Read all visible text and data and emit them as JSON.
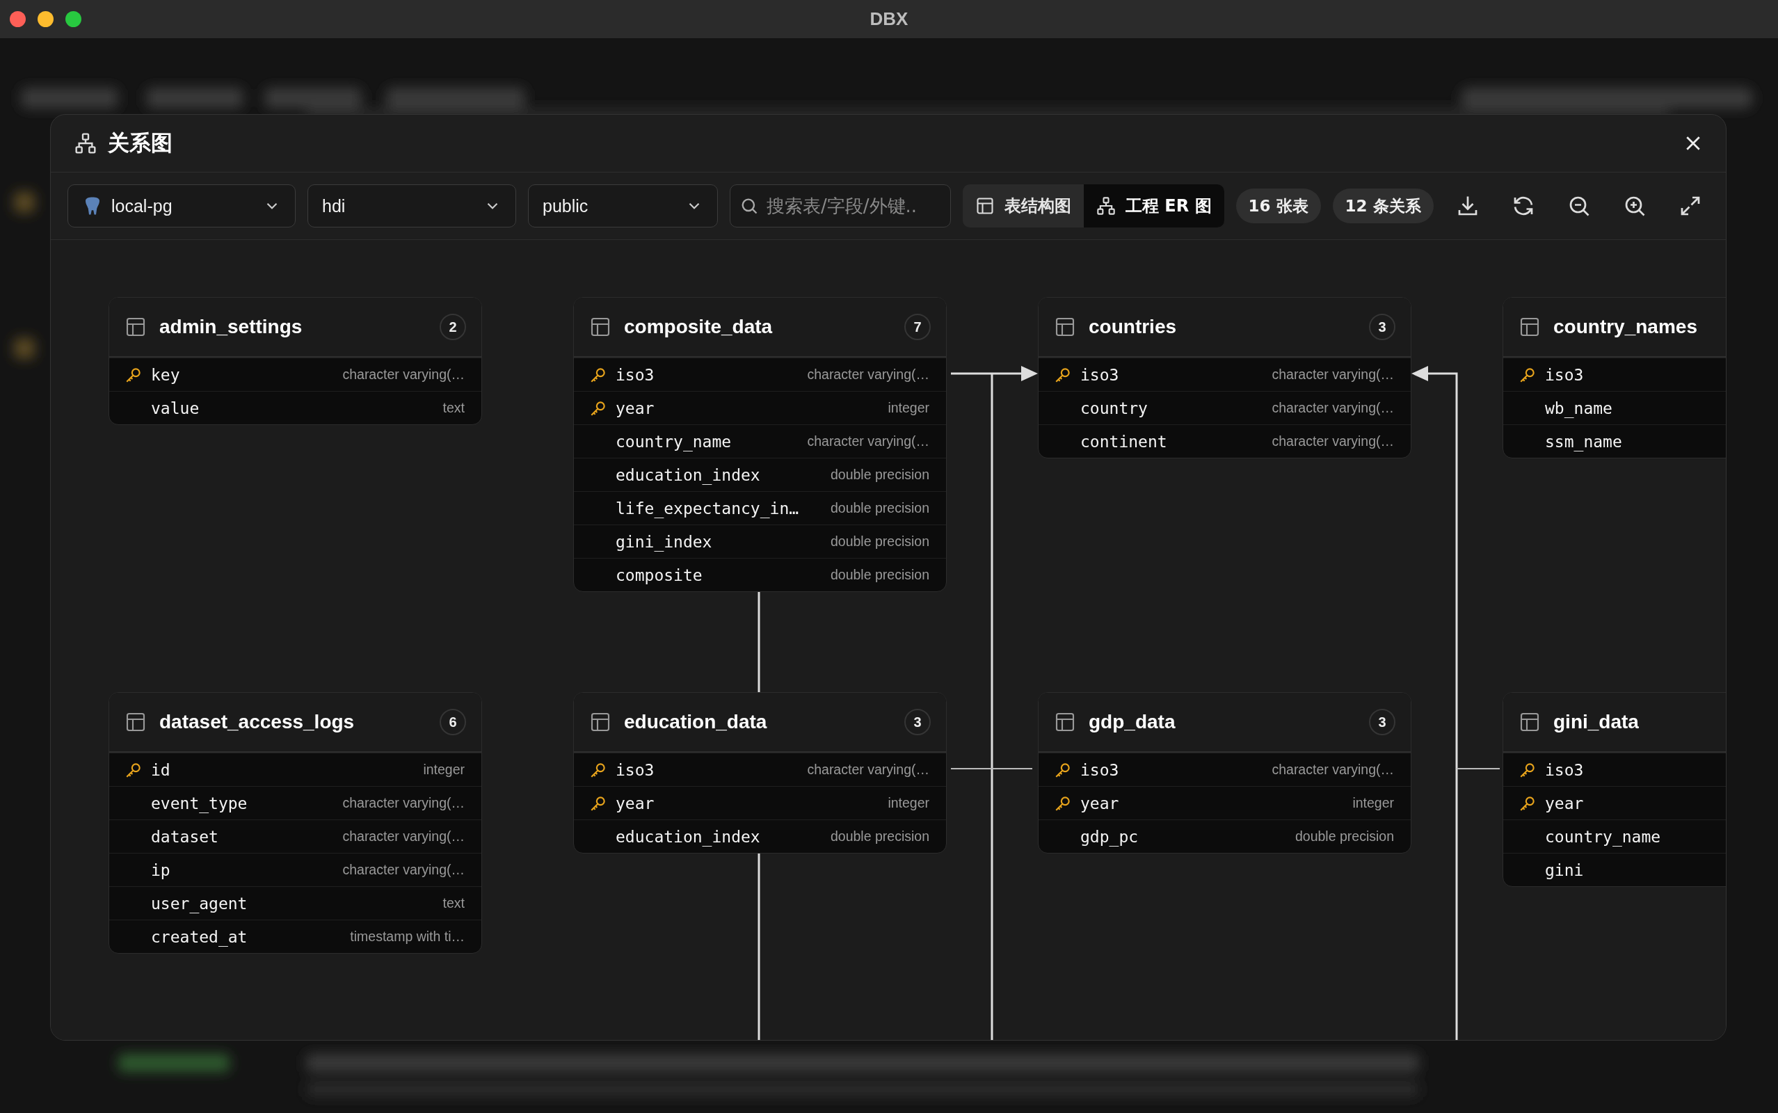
{
  "window": {
    "title": "DBX"
  },
  "dialog": {
    "title": "关系图",
    "toolbar": {
      "connection": "local-pg",
      "database": "hdi",
      "schema": "public",
      "search": {
        "placeholder": "搜索表/字段/外键.."
      },
      "views": [
        {
          "label": "表结构图",
          "selected": false
        },
        {
          "label": "工程 ER 图",
          "selected": true
        }
      ],
      "table_count": "16 张表",
      "relation_count": "12 条关系"
    },
    "tables": [
      {
        "name": "admin_settings",
        "count": "2",
        "columns": [
          {
            "name": "key",
            "type": "character varying(…",
            "primary_key": true
          },
          {
            "name": "value",
            "type": "text",
            "primary_key": false
          }
        ]
      },
      {
        "name": "composite_data",
        "count": "7",
        "columns": [
          {
            "name": "iso3",
            "type": "character varying(…",
            "primary_key": true
          },
          {
            "name": "year",
            "type": "integer",
            "primary_key": true
          },
          {
            "name": "country_name",
            "type": "character varying(…",
            "primary_key": false
          },
          {
            "name": "education_index",
            "type": "double precision",
            "primary_key": false
          },
          {
            "name": "life_expectancy_in…",
            "type": "double precision",
            "primary_key": false
          },
          {
            "name": "gini_index",
            "type": "double precision",
            "primary_key": false
          },
          {
            "name": "composite",
            "type": "double precision",
            "primary_key": false
          }
        ]
      },
      {
        "name": "countries",
        "count": "3",
        "columns": [
          {
            "name": "iso3",
            "type": "character varying(…",
            "primary_key": true
          },
          {
            "name": "country",
            "type": "character varying(…",
            "primary_key": false
          },
          {
            "name": "continent",
            "type": "character varying(…",
            "primary_key": false
          }
        ]
      },
      {
        "name": "country_names",
        "columns": [
          {
            "name": "iso3",
            "primary_key": true
          },
          {
            "name": "wb_name",
            "primary_key": false
          },
          {
            "name": "ssm_name",
            "primary_key": false
          }
        ]
      },
      {
        "name": "dataset_access_logs",
        "count": "6",
        "columns": [
          {
            "name": "id",
            "type": "integer",
            "primary_key": true
          },
          {
            "name": "event_type",
            "type": "character varying(…",
            "primary_key": false
          },
          {
            "name": "dataset",
            "type": "character varying(…",
            "primary_key": false
          },
          {
            "name": "ip",
            "type": "character varying(…",
            "primary_key": false
          },
          {
            "name": "user_agent",
            "type": "text",
            "primary_key": false
          },
          {
            "name": "created_at",
            "type": "timestamp with ti…",
            "primary_key": false
          }
        ]
      },
      {
        "name": "education_data",
        "count": "3",
        "columns": [
          {
            "name": "iso3",
            "type": "character varying(…",
            "primary_key": true
          },
          {
            "name": "year",
            "type": "integer",
            "primary_key": true
          },
          {
            "name": "education_index",
            "type": "double precision",
            "primary_key": false
          }
        ]
      },
      {
        "name": "gdp_data",
        "count": "3",
        "columns": [
          {
            "name": "iso3",
            "type": "character varying(…",
            "primary_key": true
          },
          {
            "name": "year",
            "type": "integer",
            "primary_key": true
          },
          {
            "name": "gdp_pc",
            "type": "double precision",
            "primary_key": false
          }
        ]
      },
      {
        "name": "gini_data",
        "columns": [
          {
            "name": "iso3",
            "primary_key": true
          },
          {
            "name": "year",
            "primary_key": true
          },
          {
            "name": "country_name",
            "primary_key": false
          },
          {
            "name": "gini",
            "primary_key": false
          }
        ]
      }
    ]
  }
}
